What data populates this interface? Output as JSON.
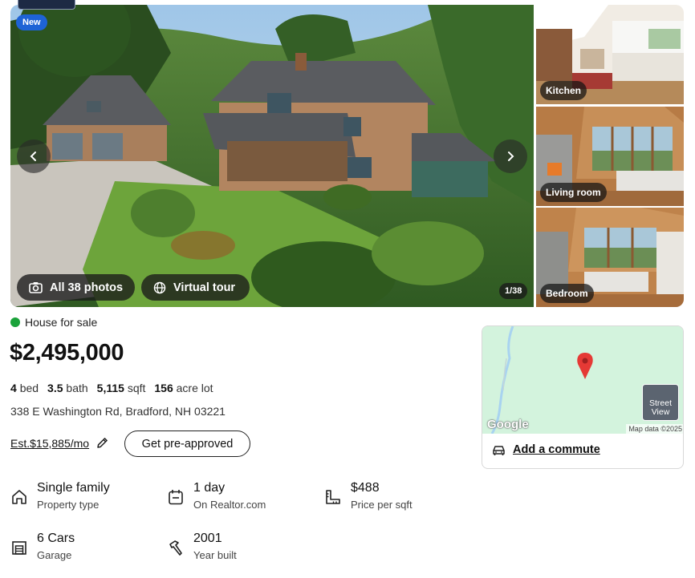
{
  "gallery": {
    "badge": "New",
    "photos_button": "All 38 photos",
    "tour_button": "Virtual tour",
    "counter": "1/38",
    "thumbnails": [
      {
        "label": "Kitchen"
      },
      {
        "label": "Living room"
      },
      {
        "label": "Bedroom"
      }
    ]
  },
  "listing": {
    "status": "House for sale",
    "status_color": "#1aa23a",
    "price": "$2,495,000",
    "beds": "4",
    "beds_unit": "bed",
    "baths": "3.5",
    "baths_unit": "bath",
    "sqft": "5,115",
    "sqft_unit": "sqft",
    "lot": "156",
    "lot_unit": "acre lot",
    "address": "338 E Washington Rd, Bradford, NH 03221",
    "estimate": "Est.$15,885/mo",
    "preapproved_button": "Get pre-approved"
  },
  "map": {
    "street_view": "Street View",
    "google": "Google",
    "map_data": "Map data ©2025",
    "commute": "Add a commute"
  },
  "facts": [
    {
      "value": "Single family",
      "label": "Property type",
      "icon": "house-icon"
    },
    {
      "value": "1 day",
      "label": "On Realtor.com",
      "icon": "calendar-icon"
    },
    {
      "value": "$488",
      "label": "Price per sqft",
      "icon": "ruler-icon"
    },
    {
      "value": "6 Cars",
      "label": "Garage",
      "icon": "garage-icon"
    },
    {
      "value": "2001",
      "label": "Year built",
      "icon": "hammer-icon"
    }
  ],
  "colors": {
    "badge_blue": "#1e63d6",
    "map_green": "#d3f3dd",
    "pin_red": "#e53935"
  }
}
